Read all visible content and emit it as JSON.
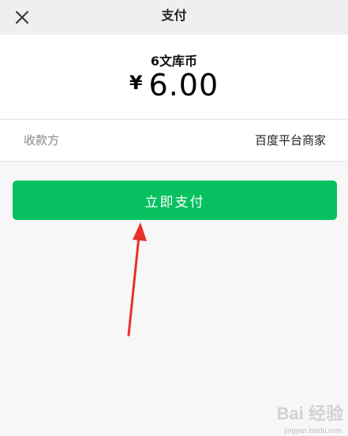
{
  "header": {
    "title": "支付",
    "close_icon": "close-icon"
  },
  "order": {
    "product_name": "6文库币",
    "currency_symbol": "¥",
    "amount": "6.00"
  },
  "payee": {
    "label": "收款方",
    "value": "百度平台商家"
  },
  "actions": {
    "pay_label": "立即支付",
    "button_color": "#07c160"
  },
  "annotation": {
    "arrow_color": "#e8322a",
    "arrow_icon": "arrow-up-icon"
  },
  "watermark": {
    "brand": "Bai 经验",
    "url": "jingyan.baidu.com"
  }
}
